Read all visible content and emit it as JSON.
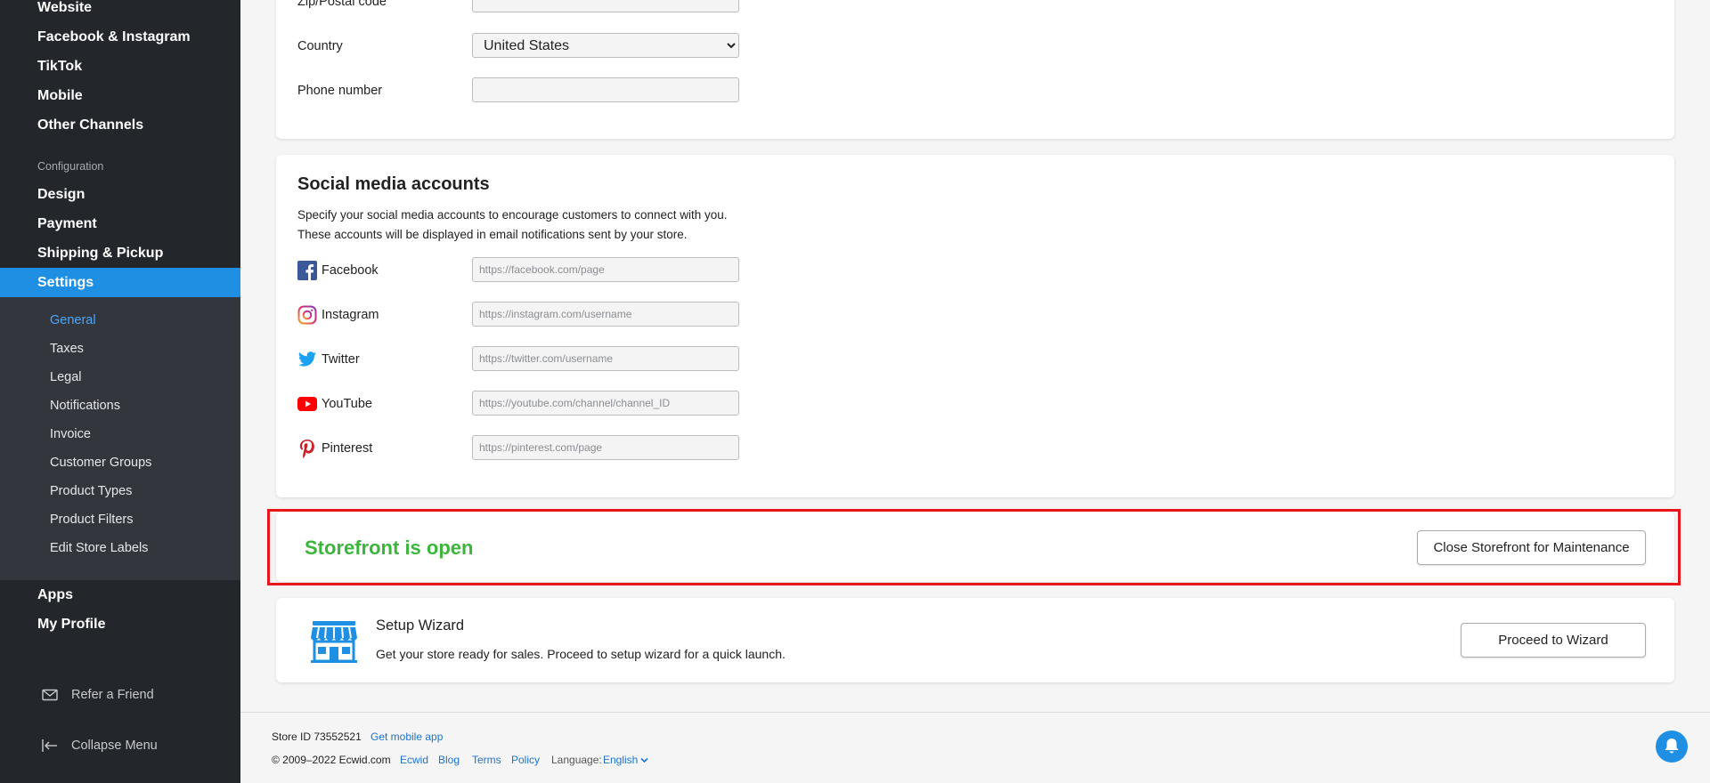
{
  "sidebar": {
    "channels": [
      "Website",
      "Facebook & Instagram",
      "TikTok",
      "Mobile",
      "Other Channels"
    ],
    "configuration_label": "Configuration",
    "config_items": [
      "Design",
      "Payment",
      "Shipping & Pickup",
      "Settings"
    ],
    "settings_sub": [
      "General",
      "Taxes",
      "Legal",
      "Notifications",
      "Invoice",
      "Customer Groups",
      "Product Types",
      "Product Filters",
      "Edit Store Labels"
    ],
    "bottom_items": [
      "Apps",
      "My Profile"
    ],
    "refer_friend": "Refer a Friend",
    "collapse_menu": "Collapse Menu",
    "active_color": "#1e8fe3"
  },
  "address": {
    "zip_label": "Zip/Postal code",
    "zip_value": "",
    "country_label": "Country",
    "country_value": "United States",
    "phone_label": "Phone number",
    "phone_value": ""
  },
  "social": {
    "title": "Social media accounts",
    "description": "Specify your social media accounts to encourage customers to connect with you. These accounts will be displayed in email notifications sent by your store.",
    "accounts": [
      {
        "name": "Facebook",
        "placeholder": "https://facebook.com/page",
        "icon": "facebook-icon"
      },
      {
        "name": "Instagram",
        "placeholder": "https://instagram.com/username",
        "icon": "instagram-icon"
      },
      {
        "name": "Twitter",
        "placeholder": "https://twitter.com/username",
        "icon": "twitter-icon"
      },
      {
        "name": "YouTube",
        "placeholder": "https://youtube.com/channel/channel_ID",
        "icon": "youtube-icon"
      },
      {
        "name": "Pinterest",
        "placeholder": "https://pinterest.com/page",
        "icon": "pinterest-icon"
      }
    ]
  },
  "storefront": {
    "status": "Storefront is open",
    "status_color": "#3bb53b",
    "close_button": "Close Storefront for Maintenance",
    "highlight_color": "#e8151b"
  },
  "wizard": {
    "title": "Setup Wizard",
    "description": "Get your store ready for sales. Proceed to setup wizard for a quick launch.",
    "button": "Proceed to Wizard",
    "icon": "storefront-icon"
  },
  "footer": {
    "store_id": "Store ID 73552521",
    "get_app": "Get mobile app",
    "copyright": "© 2009–2022 Ecwid.com",
    "links": [
      "Ecwid",
      "Blog",
      "Terms",
      "Policy"
    ],
    "language_label": "Language:",
    "language_value": "English"
  }
}
